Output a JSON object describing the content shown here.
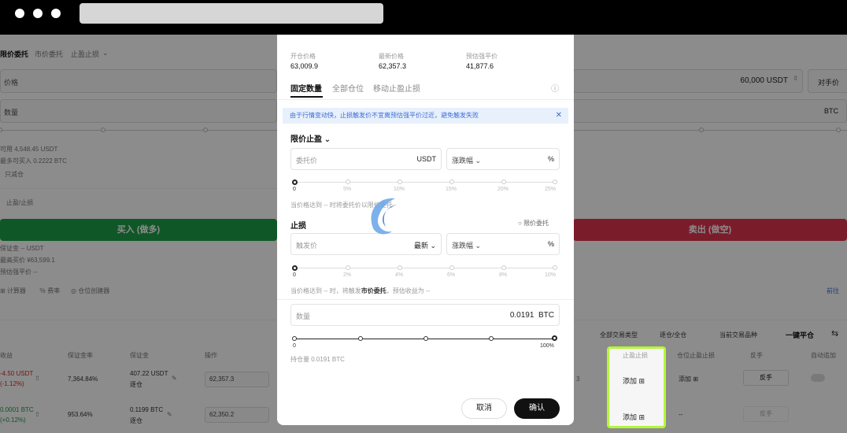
{
  "order_tabs": {
    "limit": "限价委托",
    "market": "市价委托",
    "tpsl": "止盈止损"
  },
  "price_field": {
    "placeholder": "价格",
    "value": "60,000 USDT",
    "counter_price": "对手价"
  },
  "qty_field": {
    "placeholder": "数量",
    "unit": "BTC"
  },
  "account": {
    "available": "可用 4,548.45 USDT",
    "max_buy": "最多可买入 0.2222 BTC",
    "reduce_only": "只减仓",
    "tpsl_toggle": "止盈/止损"
  },
  "buy_button": "买入 (做多)",
  "sell_button": "卖出 (做空)",
  "buy_info": {
    "margin": "保证金 -- USDT",
    "max": "最高买价 ¥63,599.1",
    "liq": "预估强平价 --"
  },
  "tools": {
    "calculator": "计算器",
    "fee": "费率",
    "position_builder": "仓位创建器",
    "go": "前往"
  },
  "positions_toolbar": {
    "filter_all": "全部交易类型",
    "mode": "逐仓/全仓",
    "current_only": "当前交易品种",
    "close_all": "一键平仓"
  },
  "positions_headers": {
    "pnl": "收益",
    "margin_ratio": "保证金率",
    "margin": "保证金",
    "action": "操作",
    "tpsl": "止盈止损",
    "pos_tpsl": "仓位止盈止损",
    "reverse": "反手",
    "auto_add": "自动追加"
  },
  "positions": [
    {
      "pnl": "-4.50 USDT",
      "pnl_pct": "(-1.12%)",
      "margin_ratio": "7,364.84%",
      "margin": "407.22 USDT",
      "margin_mode": "逐仓",
      "price": "62,357.3",
      "tail": "3",
      "tpsl": "添加",
      "pos_tpsl": "添加",
      "reverse": "反手"
    },
    {
      "pnl": "0.0001 BTC",
      "pnl_pct": "(+0.12%)",
      "margin_ratio": "953.64%",
      "margin": "0.1199 BTC",
      "margin_mode": "逐仓",
      "price": "62,350.2",
      "tail": "",
      "tpsl": "添加",
      "pos_tpsl": "--",
      "reverse": "反手"
    }
  ],
  "modal": {
    "open_price_label": "开仓价格",
    "open_price": "63,009.9",
    "latest_price_label": "最新价格",
    "latest_price": "62,357.3",
    "liq_price_label": "预估强平价",
    "liq_price": "41,877.6",
    "tabs": [
      "固定数量",
      "全部仓位",
      "移动止盈止损"
    ],
    "notice": "由于行情变动快，止损触发价不宜离预估强平价过近，避免触发失败",
    "tp_title": "限价止盈",
    "tp_input_placeholder": "委托价",
    "tp_input_unit": "USDT",
    "tp_pct_select": "涨跌幅",
    "pct_unit": "%",
    "tp_ticks": [
      "0",
      "5%",
      "10%",
      "15%",
      "20%",
      "25%"
    ],
    "tp_hint": "当价格达到 -- 时将委托价以限价委托",
    "sl_title": "止损",
    "sl_limit": "限价委托",
    "sl_input_placeholder": "触发价",
    "sl_latest": "最新",
    "sl_pct_select": "涨跌幅",
    "sl_ticks": [
      "0",
      "2%",
      "4%",
      "6%",
      "8%",
      "10%"
    ],
    "sl_hint_pre": "当价格达到 -- 时，将触发",
    "sl_hint_bold": "市价委托",
    "sl_hint_post": "，预估收益为 --",
    "qty_placeholder": "数量",
    "qty_value": "0.0191",
    "qty_unit": "BTC",
    "qty_ticks_end": "100%",
    "qty_ticks_start": "0",
    "holding": "持仓量 0.0191 BTC",
    "cancel": "取消",
    "confirm": "确认"
  },
  "watermark": "币圈子"
}
